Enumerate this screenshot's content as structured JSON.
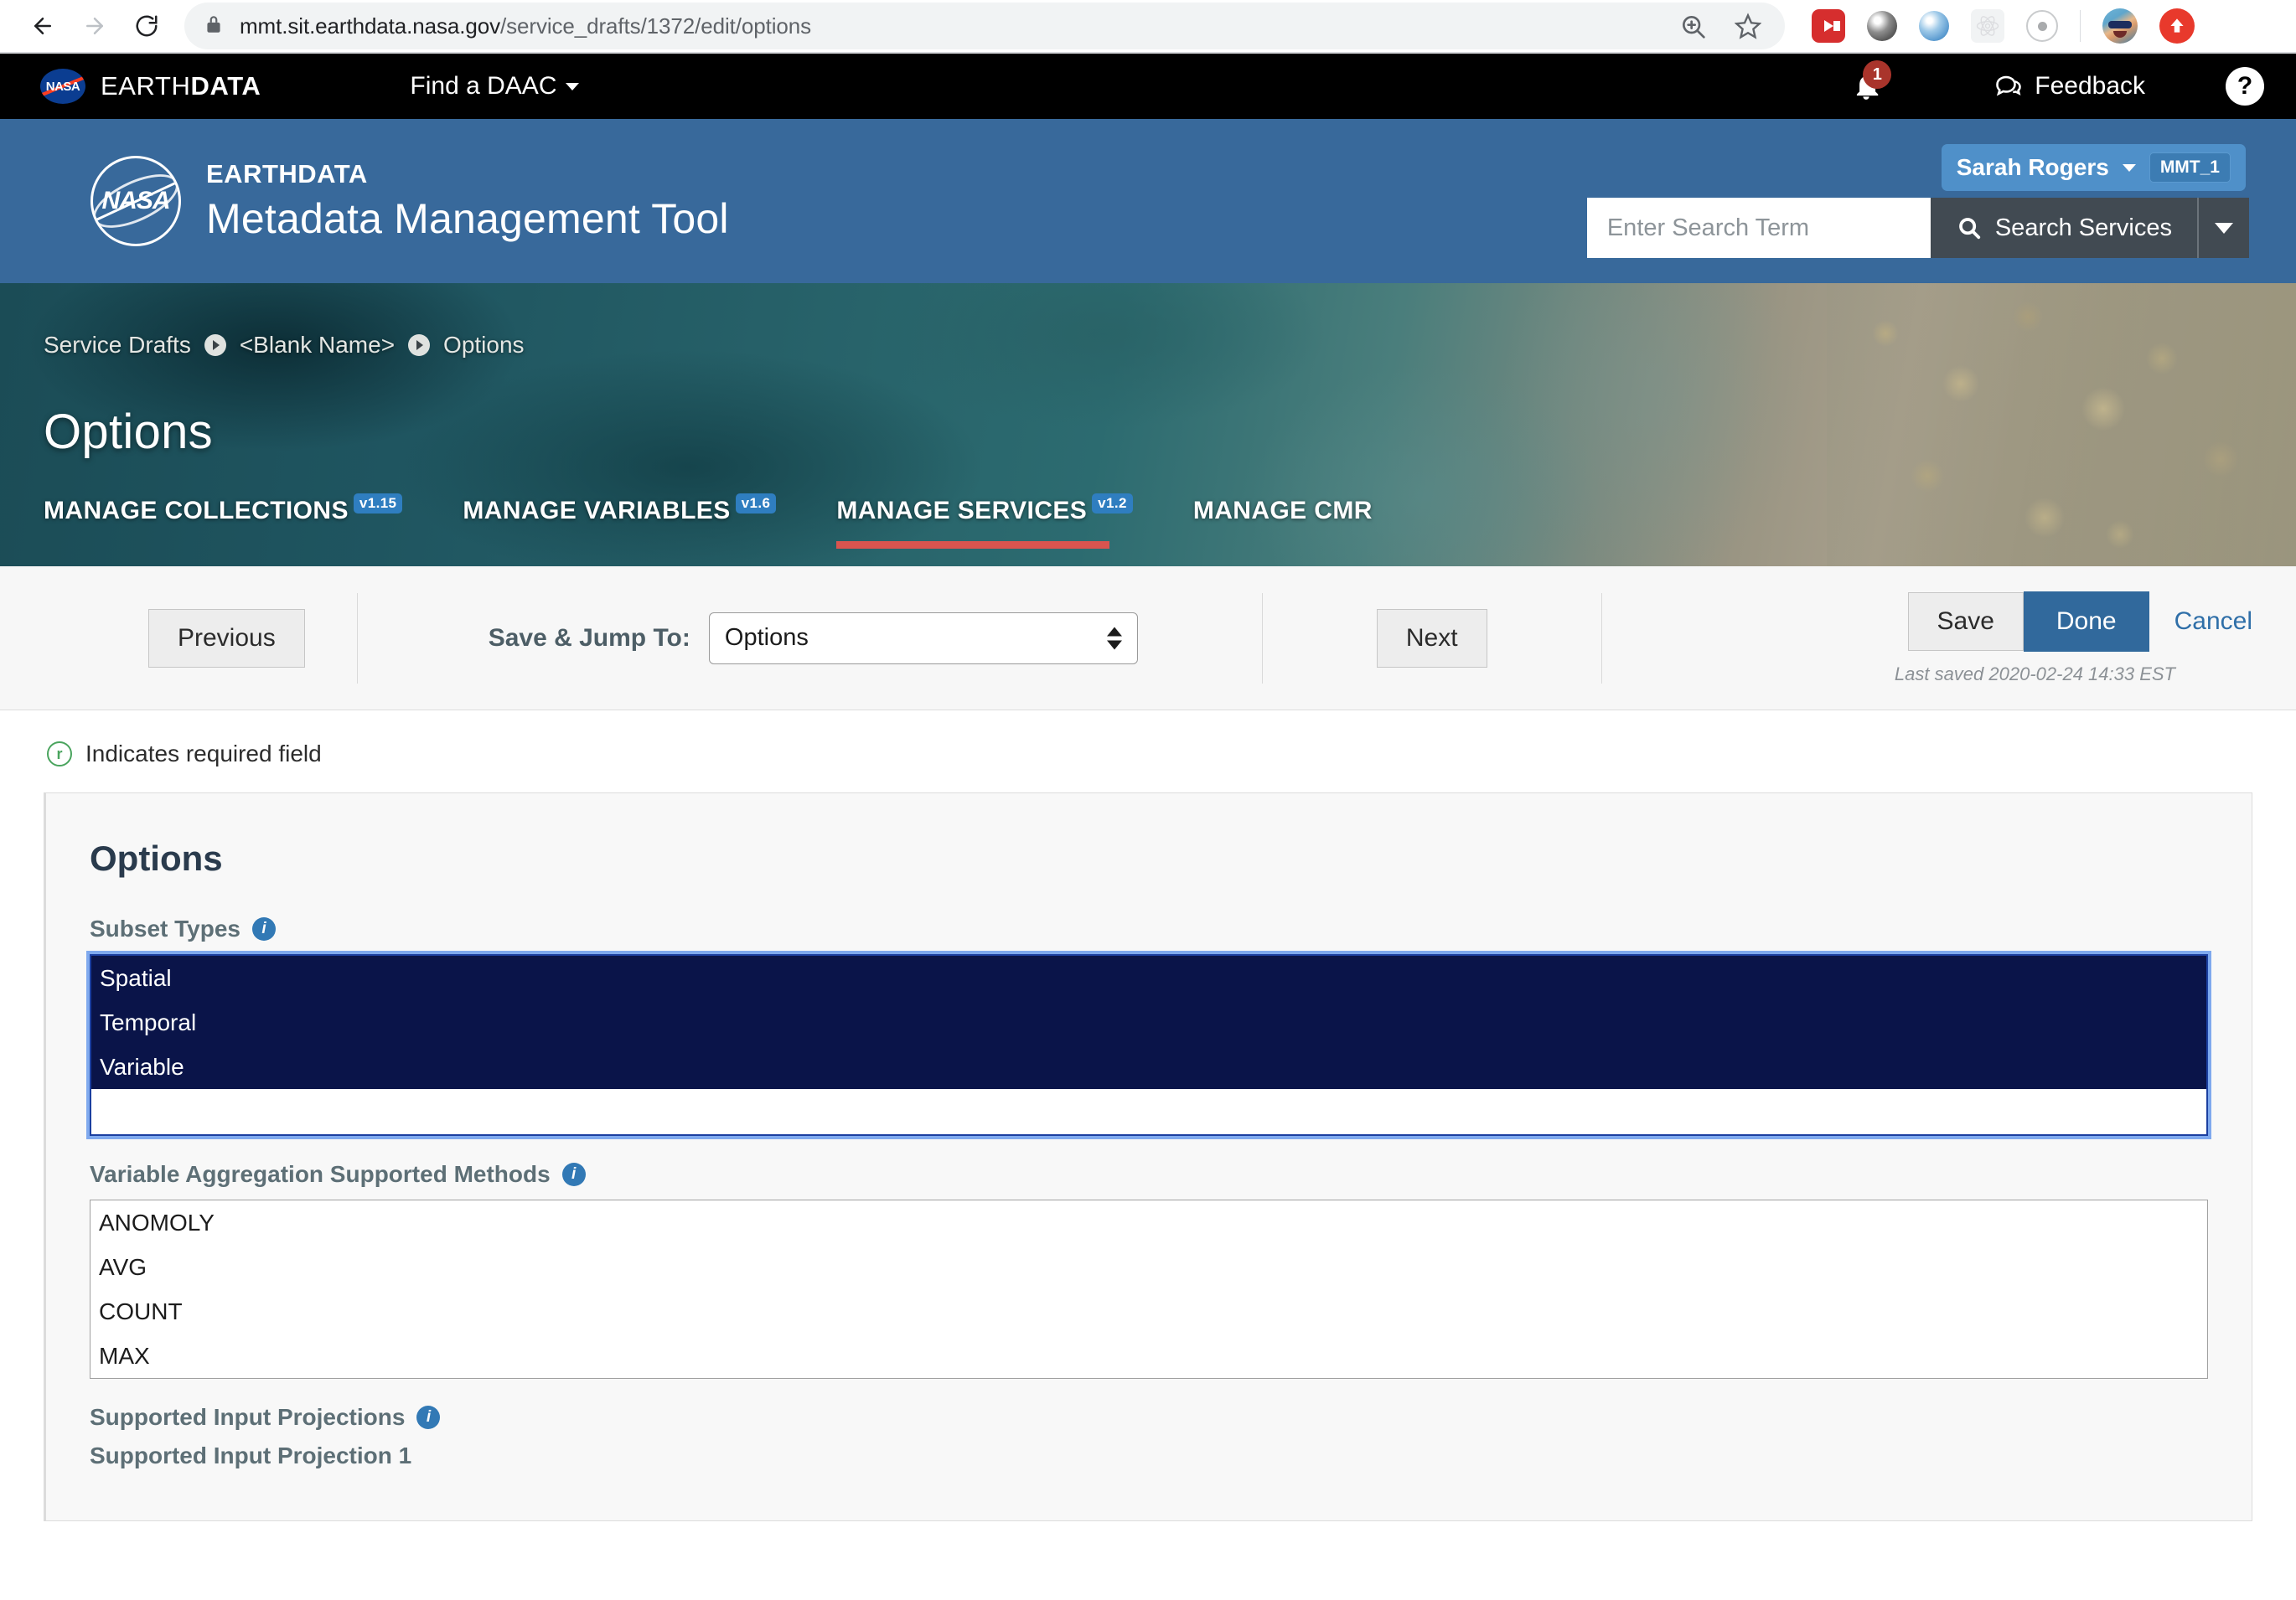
{
  "browser": {
    "url_domain": "mmt.sit.earthdata.nasa.gov",
    "url_path": "/service_drafts/1372/edit/options",
    "back_icon": "back-arrow-icon",
    "forward_icon": "forward-arrow-icon",
    "reload_icon": "reload-icon",
    "lock_icon": "lock-icon",
    "zoom_icon": "zoom-in-icon",
    "bookmark_icon": "star-icon",
    "extensions": [
      "youtube-extension-icon",
      "gray-ring-extension-icon",
      "blue-ring-extension-icon",
      "react-devtools-icon",
      "ionic-extension-icon"
    ],
    "profile_icon": "user-avatar",
    "update_icon": "update-arrow-icon"
  },
  "nasa_bar": {
    "logo_text": "NASA",
    "wordmark_light": "EARTH",
    "wordmark_bold": "DATA",
    "find_daac": "Find a DAAC",
    "notification_count": "1",
    "feedback": "Feedback",
    "help": "?"
  },
  "mmt_header": {
    "meatball_text": "NASA",
    "eyebrow": "EARTHDATA",
    "title": "Metadata Management Tool",
    "user_name": "Sarah Rogers",
    "user_provider": "MMT_1",
    "search_placeholder": "Enter Search Term",
    "search_value": "",
    "search_button": "Search Services"
  },
  "banner": {
    "breadcrumb": [
      "Service Drafts",
      "<Blank Name>",
      "Options"
    ],
    "page_title": "Options",
    "tabs": [
      {
        "label": "MANAGE COLLECTIONS",
        "version": "v1.15",
        "active": false
      },
      {
        "label": "MANAGE VARIABLES",
        "version": "v1.6",
        "active": false
      },
      {
        "label": "MANAGE SERVICES",
        "version": "v1.2",
        "active": true
      },
      {
        "label": "MANAGE CMR",
        "version": "",
        "active": false
      }
    ]
  },
  "toolbar": {
    "previous": "Previous",
    "jump_label": "Save & Jump To:",
    "jump_value": "Options",
    "next": "Next",
    "save": "Save",
    "done": "Done",
    "cancel": "Cancel",
    "last_saved": "Last saved 2020-02-24 14:33 EST"
  },
  "required_note": {
    "icon_char": "r",
    "text": "Indicates required field"
  },
  "form": {
    "section_title": "Options",
    "subset_types": {
      "label": "Subset Types",
      "options": [
        {
          "text": "Spatial",
          "selected": true
        },
        {
          "text": "Temporal",
          "selected": true
        },
        {
          "text": "Variable",
          "selected": true
        },
        {
          "text": "",
          "selected": false
        }
      ]
    },
    "variable_aggregation": {
      "label": "Variable Aggregation Supported Methods",
      "options": [
        {
          "text": "ANOMOLY",
          "selected": false
        },
        {
          "text": "AVG",
          "selected": false
        },
        {
          "text": "COUNT",
          "selected": false
        },
        {
          "text": "MAX",
          "selected": false
        }
      ]
    },
    "supported_input_projections": {
      "label": "Supported Input Projections",
      "sub_label": "Supported Input Projection 1"
    }
  },
  "colors": {
    "nasa_blue": "#0b3d91",
    "mmt_header_blue": "#38699b",
    "accent_red": "#d9544f",
    "done_blue": "#31699c",
    "link_blue": "#2f6fa8",
    "select_navy": "#0a1449",
    "badge_blue": "#2f7ec0"
  }
}
